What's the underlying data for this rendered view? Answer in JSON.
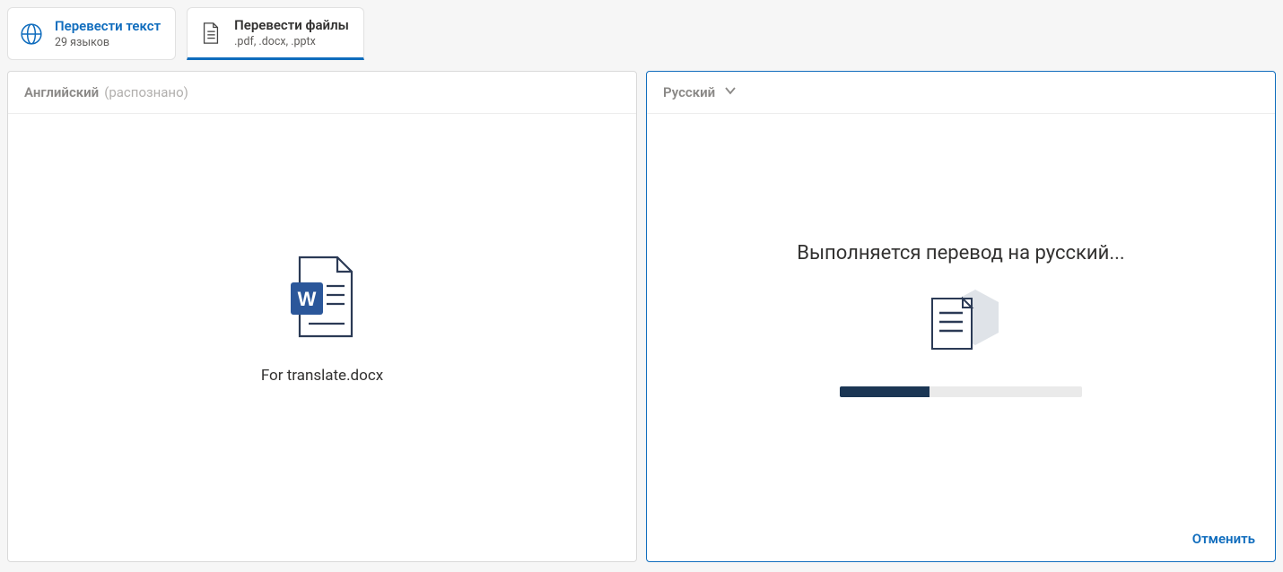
{
  "tabs": {
    "text": {
      "title": "Перевести текст",
      "sub": "29 языков"
    },
    "files": {
      "title": "Перевести файлы",
      "sub": ".pdf, .docx, .pptx"
    }
  },
  "source": {
    "lang": "Английский",
    "meta": "(распознано)",
    "filename": "For translate.docx"
  },
  "target": {
    "lang": "Русский",
    "status": "Выполняется перевод на русский...",
    "progress_percent": 37,
    "cancel": "Отменить"
  },
  "colors": {
    "accent": "#0F6CBD",
    "word_blue": "#2B579A",
    "progress": "#1b3654"
  }
}
